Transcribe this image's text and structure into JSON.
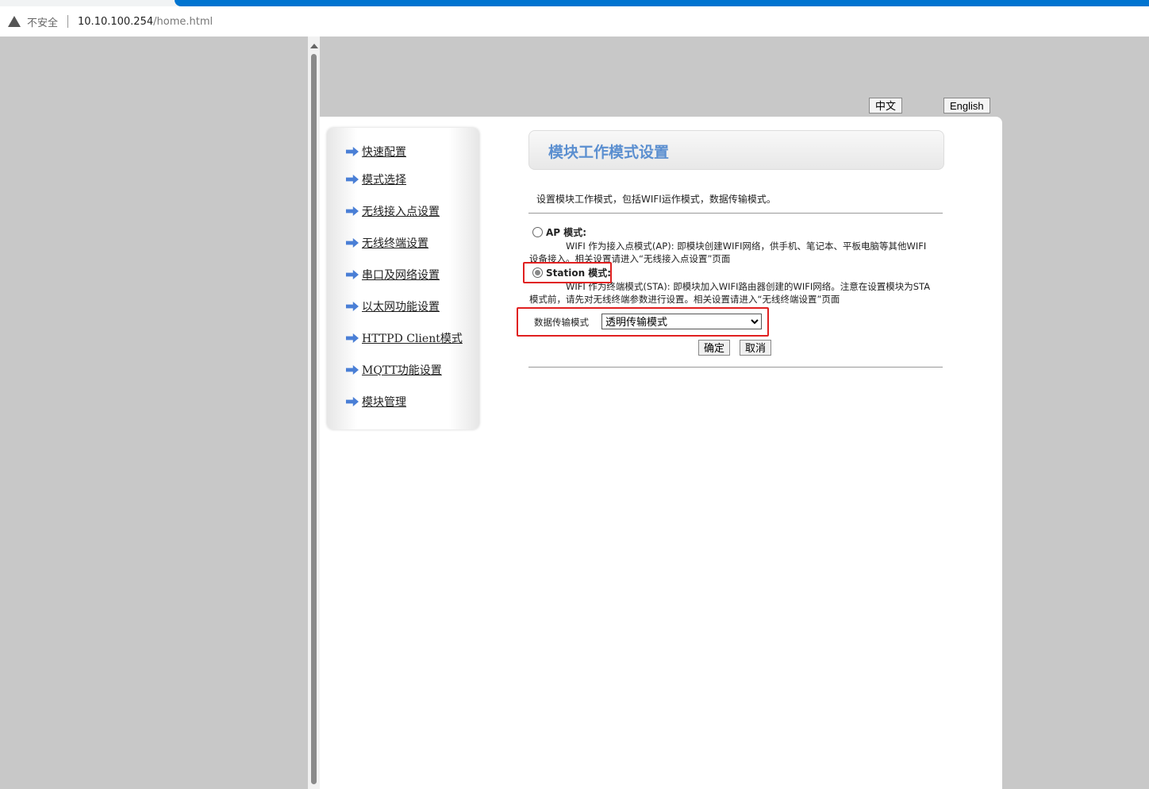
{
  "browser": {
    "security_label": "不安全",
    "url_host": "10.10.100.254",
    "url_path": "/home.html"
  },
  "lang": {
    "zh": "中文",
    "en": "English"
  },
  "sidebar": {
    "items": [
      {
        "label": "快速配置"
      },
      {
        "label": "模式选择"
      },
      {
        "label": "无线接入点设置"
      },
      {
        "label": "无线终端设置"
      },
      {
        "label": "串口及网络设置"
      },
      {
        "label": "以太网功能设置"
      },
      {
        "label": "HTTPD Client模式"
      },
      {
        "label": "MQTT功能设置"
      },
      {
        "label": "模块管理"
      }
    ]
  },
  "main": {
    "title": "模块工作模式设置",
    "description": "设置模块工作模式，包括WIFI运作模式，数据传输模式。",
    "ap": {
      "label": "AP 模式:",
      "selected": false,
      "text1": "WIFI 作为接入点模式(AP): 即模块创建WIFI网络，供手机、笔记本、平板电脑等其他WIFI",
      "text2": "设备接入。相关设置请进入“无线接入点设置”页面"
    },
    "sta": {
      "label": "Station 模式:",
      "selected": true,
      "text1": "WIFI 作为终端模式(STA): 即模块加入WIFI路由器创建的WIFI网络。注意在设置模块为STA",
      "text2": "模式前，请先对无线终端参数进行设置。相关设置请进入“无线终端设置”页面"
    },
    "transfer": {
      "label": "数据传输模式",
      "value": "透明传输模式"
    },
    "ok": "确定",
    "cancel": "取消",
    "highlight_color": "#e02020"
  }
}
